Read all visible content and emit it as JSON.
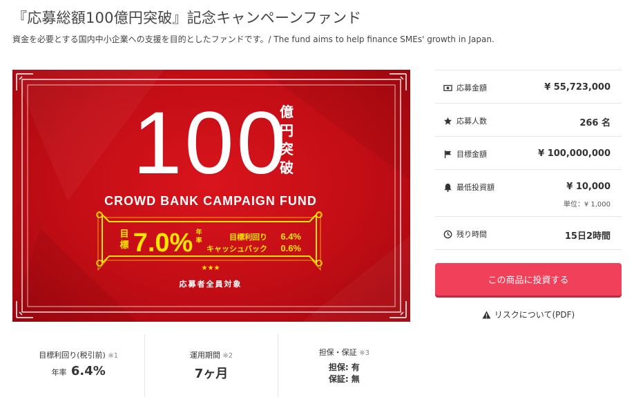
{
  "page": {
    "title": "『応募総額100億円突破』記念キャンペーンファンド",
    "description": "資金を必要とする国内中小企業への支援を目的としたファンドです。/ The fund aims to help finance SMEs' growth in Japan."
  },
  "banner": {
    "big_number": "100",
    "unit_chars": [
      "億",
      "円",
      "突",
      "破"
    ],
    "fund_name": "CROWD BANK CAMPAIGN FUND",
    "target_chars": [
      "目",
      "標"
    ],
    "target_rate": "7.0%",
    "annual_chars": [
      "年",
      "率"
    ],
    "yield_label": "目標利回り",
    "yield_value": "6.4%",
    "cashback_label": "キャッシュバック",
    "cashback_value": "0.6%",
    "stars": "★★★",
    "footer": "応募者全員対象",
    "colors": {
      "background": "#c8101a",
      "accent": "#ffe600",
      "frame": "#ffffff"
    }
  },
  "info": {
    "rows": [
      {
        "icon": "money-icon",
        "label": "応募金額",
        "value": "¥ 55,723,000"
      },
      {
        "icon": "star-icon",
        "label": "応募人数",
        "value": "266 名"
      },
      {
        "icon": "flag-icon",
        "label": "目標金額",
        "value": "¥ 100,000,000"
      },
      {
        "icon": "bell-icon",
        "label": "最低投資額",
        "value": "¥ 10,000",
        "sub": "単位：¥ 1,000"
      },
      {
        "icon": "clock-icon",
        "label": "残り時間",
        "value": "15日2時間"
      }
    ]
  },
  "actions": {
    "invest_label": "この商品に投資する",
    "invest_color": "#f0405a",
    "risk_label": "リスクについて(PDF)"
  },
  "stats": {
    "yield": {
      "label": "目標利回り(税引前)",
      "note": "※1",
      "prefix": "年率",
      "value": "6.4%"
    },
    "period": {
      "label": "運用期間",
      "note": "※2",
      "value": "7ヶ月"
    },
    "collateral": {
      "label": "担保・保証",
      "note": "※3",
      "line1": "担保: 有",
      "line2": "保証: 無"
    }
  }
}
